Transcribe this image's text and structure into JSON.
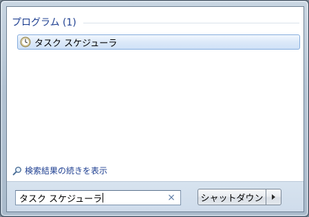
{
  "results": {
    "group_title": "プログラム (1)",
    "items": [
      {
        "label": "タスク スケジューラ",
        "icon": "clock-icon"
      }
    ],
    "see_more_label": "検索結果の続きを表示",
    "see_more_icon": "magnifier-icon"
  },
  "search": {
    "value": "タスク スケジューラ",
    "clear_icon": "×"
  },
  "shutdown": {
    "label": "シャットダウン",
    "arrow_icon": "right-arrow-icon"
  },
  "colors": {
    "link_blue": "#1e3f91",
    "selection_border": "#84acdd",
    "footer_bg": "#d7e3ef"
  }
}
